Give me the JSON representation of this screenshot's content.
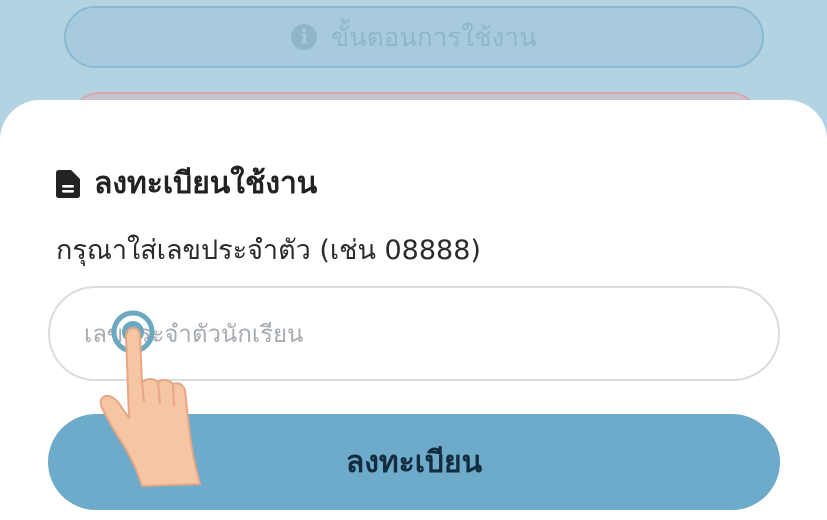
{
  "background": {
    "how_to_use_label": "ขั้นตอนการใช้งาน",
    "info_icon": "info-icon"
  },
  "sheet": {
    "title": "ลงทะเบียนใช้งาน",
    "title_icon": "document-icon",
    "instruction": "กรุณาใส่เลขประจำตัว (เช่น 08888)",
    "student_id_input": {
      "placeholder": "เลขประจำตัวนักเรียน",
      "value": ""
    },
    "submit_label": "ลงทะเบียน"
  },
  "colors": {
    "primary_button": "#6eaac9",
    "backdrop": "#b3d3e2"
  }
}
